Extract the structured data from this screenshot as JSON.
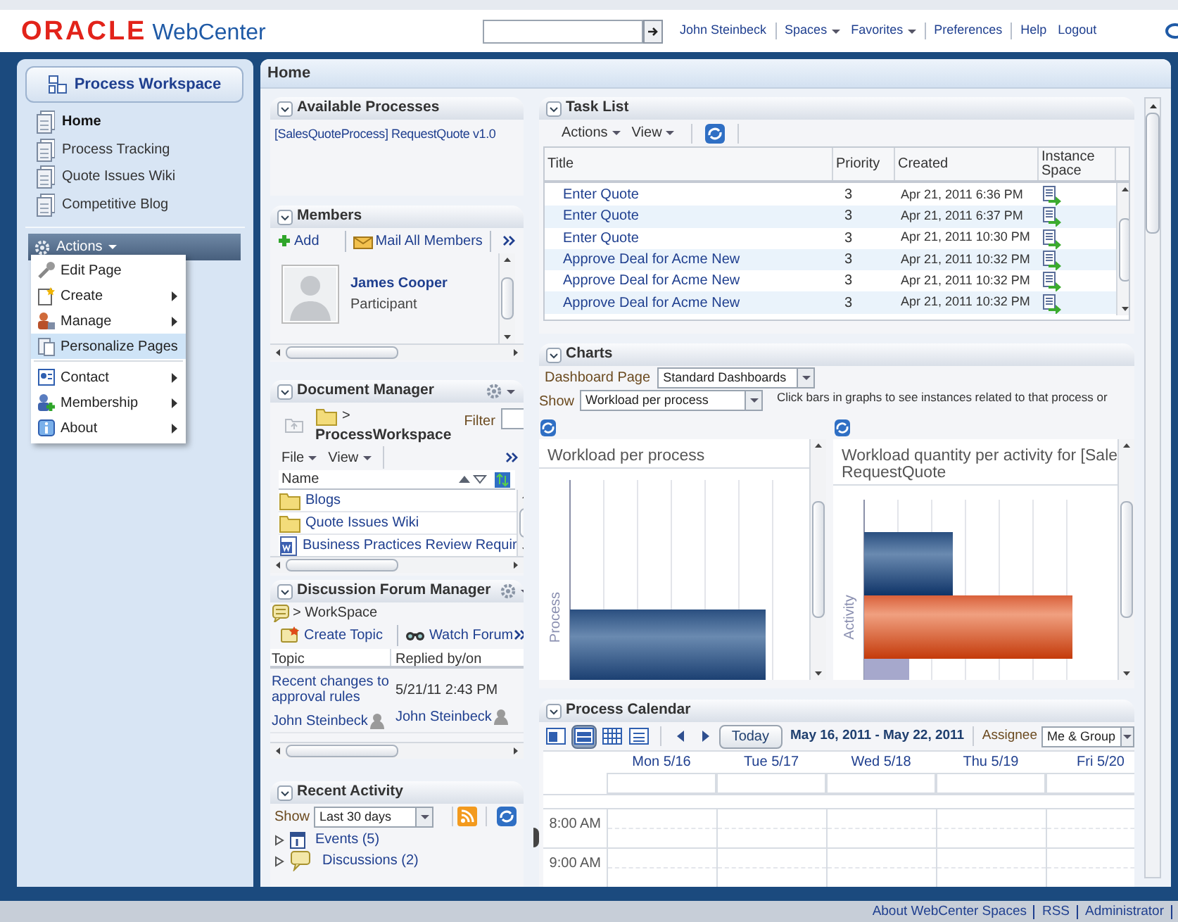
{
  "header": {
    "brand": "ORACLE",
    "product": "WebCenter",
    "nav": [
      {
        "label": "John Steinbeck",
        "kind": "link",
        "divider_after": true
      },
      {
        "label": "Spaces",
        "kind": "menu",
        "divider_after": false
      },
      {
        "label": "Favorites",
        "kind": "menu",
        "divider_after": true
      },
      {
        "label": "Preferences",
        "kind": "link",
        "divider_after": true
      },
      {
        "label": "Help",
        "kind": "link",
        "divider_after": false
      },
      {
        "label": "Logout",
        "kind": "link",
        "divider_after": false
      }
    ]
  },
  "sidebar": {
    "title": "Process Workspace",
    "pages": [
      {
        "label": "Home",
        "selected": true
      },
      {
        "label": "Process Tracking",
        "selected": false
      },
      {
        "label": "Quote Issues Wiki",
        "selected": false
      },
      {
        "label": "Competitive Blog",
        "selected": false
      }
    ],
    "actions_label": "Actions",
    "actions_menu": [
      {
        "label": "Edit Page",
        "kind": "edit",
        "submenu": false,
        "selected": false,
        "divider_before": false
      },
      {
        "label": "Create",
        "kind": "create",
        "submenu": true,
        "selected": false,
        "divider_before": false
      },
      {
        "label": "Manage",
        "kind": "manage",
        "submenu": true,
        "selected": false,
        "divider_before": false
      },
      {
        "label": "Personalize Pages",
        "kind": "personalize",
        "submenu": false,
        "selected": true,
        "divider_before": false
      },
      {
        "label": "Contact",
        "kind": "contact",
        "submenu": true,
        "selected": false,
        "divider_before": true
      },
      {
        "label": "Membership",
        "kind": "membership",
        "submenu": true,
        "selected": false,
        "divider_before": false
      },
      {
        "label": "About",
        "kind": "about",
        "submenu": true,
        "selected": false,
        "divider_before": false
      }
    ]
  },
  "breadcrumb": "Home",
  "available_processes": {
    "title": "Available Processes",
    "items": [
      "[SalesQuoteProcess] RequestQuote v1.0"
    ]
  },
  "members": {
    "title": "Members",
    "actions": [
      {
        "label": "Add",
        "kind": "add"
      },
      {
        "label": "Mail All Members",
        "kind": "mail"
      }
    ],
    "people": [
      {
        "name": "James Cooper",
        "role": "Participant"
      }
    ]
  },
  "document_manager": {
    "title": "Document Manager",
    "path_separator": ">",
    "folder": "ProcessWorkspace",
    "filter_label": "Filter",
    "menus": [
      "File",
      "View"
    ],
    "column": "Name",
    "files": [
      {
        "name": "Blogs",
        "kind": "folder"
      },
      {
        "name": "Quote Issues Wiki",
        "kind": "folder"
      },
      {
        "name": "Business Practices Review Requir",
        "kind": "document"
      }
    ]
  },
  "discussions": {
    "title": "Discussion Forum Manager",
    "path": "> WorkSpace",
    "actions": [
      {
        "label": "Create Topic",
        "kind": "create"
      },
      {
        "label": "Watch Forum",
        "kind": "watch"
      }
    ],
    "columns": [
      "Topic",
      "Replied by/on"
    ],
    "topics": [
      {
        "title": "Recent changes to approval rules",
        "author": "John Steinbeck",
        "replied_on": "5/21/11 2:43 PM",
        "replied_by": "John Steinbeck"
      }
    ]
  },
  "recent_activity": {
    "title": "Recent Activity",
    "show_label": "Show",
    "period": "Last 30 days",
    "items": [
      {
        "label": "Events (5)",
        "kind": "events"
      },
      {
        "label": "Discussions (2)",
        "kind": "discussions"
      }
    ]
  },
  "task_list": {
    "title": "Task List",
    "menus": [
      "Actions",
      "View"
    ],
    "columns": [
      "Title",
      "Priority",
      "Created",
      "Instance Space"
    ],
    "rows": [
      {
        "title": "Enter Quote",
        "priority": "3",
        "created": "Apr 21, 2011 6:36 PM"
      },
      {
        "title": "Enter Quote",
        "priority": "3",
        "created": "Apr 21, 2011 6:37 PM"
      },
      {
        "title": "Enter Quote",
        "priority": "3",
        "created": "Apr 21, 2011 10:30 PM"
      },
      {
        "title": "Approve Deal for Acme New",
        "priority": "3",
        "created": "Apr 21, 2011 10:32 PM"
      },
      {
        "title": "Approve Deal for Acme New",
        "priority": "3",
        "created": "Apr 21, 2011 10:32 PM"
      },
      {
        "title": "Approve Deal for Acme New",
        "priority": "3",
        "created": "Apr 21, 2011 10:32 PM"
      }
    ]
  },
  "charts": {
    "title": "Charts",
    "dashboard_label": "Dashboard Page",
    "dashboard": "Standard Dashboards",
    "show_label": "Show",
    "show": "Workload per process",
    "hint": "Click bars in graphs to see instances related to that process or",
    "panels": [
      {
        "title_lines": [
          "Workload per process"
        ],
        "axis_label": "Process",
        "kind": "single"
      },
      {
        "title_lines": [
          "Workload quantity per activity for [Sale",
          "RequestQuote"
        ],
        "axis_label": "Activity",
        "kind": "multi"
      }
    ]
  },
  "calendar": {
    "title": "Process Calendar",
    "views": [
      {
        "kind": "day",
        "selected": false
      },
      {
        "kind": "week",
        "selected": true
      },
      {
        "kind": "month",
        "selected": false
      },
      {
        "kind": "list",
        "selected": false
      }
    ],
    "today": "Today",
    "range": "May 16, 2011 - May 22, 2011",
    "assignee_label": "Assignee",
    "assignee": "Me & Group",
    "days": [
      "Mon 5/16",
      "Tue 5/17",
      "Wed 5/18",
      "Thu 5/19",
      "Fri 5/20"
    ],
    "times": [
      "8:00 AM",
      "9:00 AM"
    ]
  },
  "footer": {
    "links": [
      "About WebCenter Spaces",
      "RSS",
      "Administrator"
    ]
  }
}
